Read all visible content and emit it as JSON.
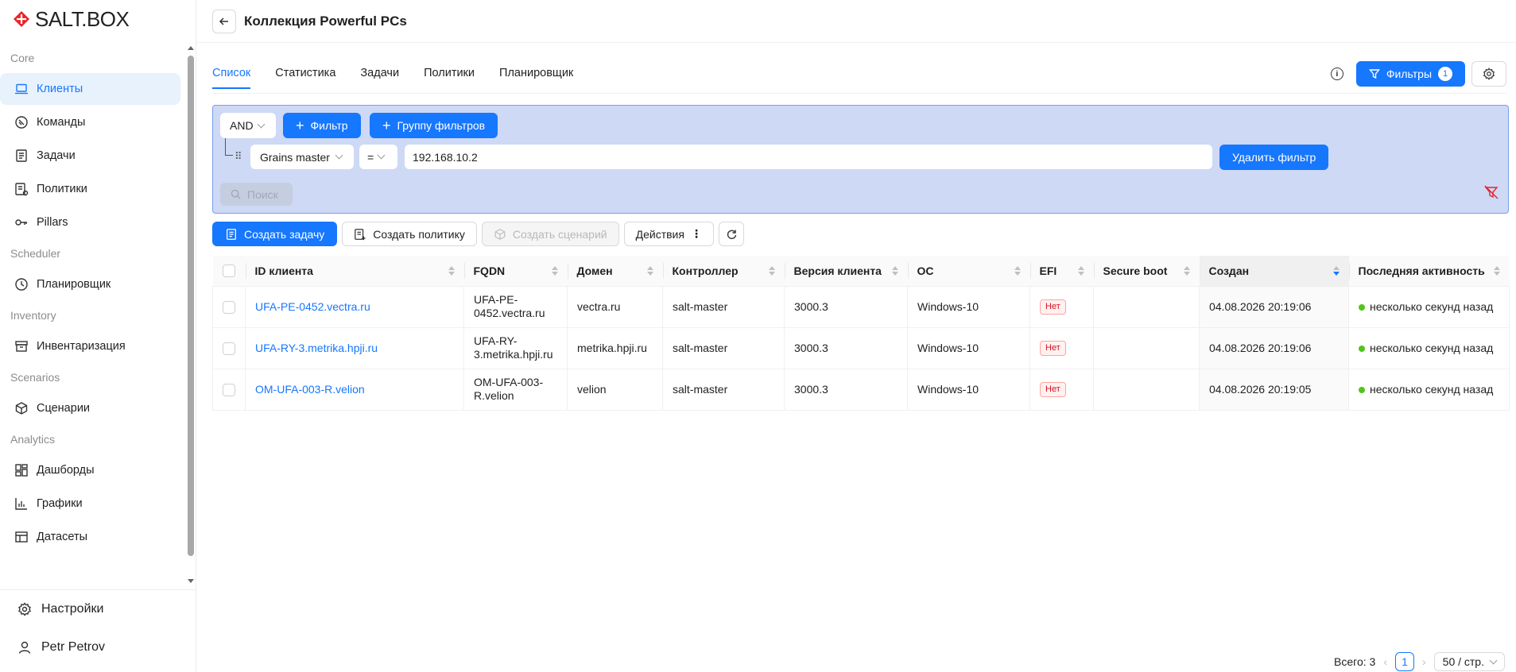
{
  "brand": {
    "logo_text": "SALT.BOX",
    "accent": "#1677ff",
    "logo_red": "#e8242a"
  },
  "sidebar": {
    "sections": [
      {
        "title": "Core",
        "items": [
          {
            "label": "Клиенты",
            "icon": "laptop-icon",
            "active": true
          },
          {
            "label": "Команды",
            "icon": "command-icon"
          },
          {
            "label": "Задачи",
            "icon": "task-list-icon"
          },
          {
            "label": "Политики",
            "icon": "policy-icon"
          },
          {
            "label": "Pillars",
            "icon": "key-icon"
          }
        ]
      },
      {
        "title": "Scheduler",
        "items": [
          {
            "label": "Планировщик",
            "icon": "clock-icon"
          }
        ]
      },
      {
        "title": "Inventory",
        "items": [
          {
            "label": "Инвентаризация",
            "icon": "archive-icon"
          }
        ]
      },
      {
        "title": "Scenarios",
        "items": [
          {
            "label": "Сценарии",
            "icon": "cube-icon"
          }
        ]
      },
      {
        "title": "Analytics",
        "items": [
          {
            "label": "Дашборды",
            "icon": "dashboard-icon"
          },
          {
            "label": "Графики",
            "icon": "chart-icon"
          },
          {
            "label": "Датасеты",
            "icon": "table-icon"
          }
        ]
      }
    ],
    "settings_label": "Настройки",
    "user_name": "Petr Petrov"
  },
  "header": {
    "title": "Коллекция Powerful PCs"
  },
  "tabs": [
    {
      "label": "Список",
      "active": true
    },
    {
      "label": "Статистика"
    },
    {
      "label": "Задачи"
    },
    {
      "label": "Политики"
    },
    {
      "label": "Планировщик"
    }
  ],
  "filters_button": {
    "label": "Фильтры",
    "count": "1"
  },
  "filter_panel": {
    "logic": "AND",
    "add_filter_label": "Фильтр",
    "add_group_label": "Группу фильтров",
    "field": "Grains master",
    "operator": "=",
    "value": "192.168.10.2",
    "delete_label": "Удалить фильтр",
    "search_label": "Поиск"
  },
  "toolbar": {
    "create_task": "Создать задачу",
    "create_policy": "Создать политику",
    "create_scenario": "Создать сценарий",
    "actions": "Действия"
  },
  "table": {
    "columns": [
      "ID клиента",
      "FQDN",
      "Домен",
      "Контроллер",
      "Версия клиента",
      "ОС",
      "EFI",
      "Secure boot",
      "Создан",
      "Последняя активность"
    ],
    "rows": [
      {
        "id": "UFA-PE-0452.vectra.ru",
        "fqdn": "UFA-PE-0452.vectra.ru",
        "domain": "vectra.ru",
        "controller": "salt-master",
        "version": "3000.3",
        "os": "Windows-10",
        "efi": "Нет",
        "secure_boot": "",
        "created": "04.08.2026 20:19:06",
        "activity": "несколько секунд назад"
      },
      {
        "id": "UFA-RY-3.metrika.hpji.ru",
        "fqdn": "UFA-RY-3.metrika.hpji.ru",
        "domain": "metrika.hpji.ru",
        "controller": "salt-master",
        "version": "3000.3",
        "os": "Windows-10",
        "efi": "Нет",
        "secure_boot": "",
        "created": "04.08.2026 20:19:06",
        "activity": "несколько секунд назад"
      },
      {
        "id": "OM-UFA-003-R.velion",
        "fqdn": "OM-UFA-003-R.velion",
        "domain": "velion",
        "controller": "salt-master",
        "version": "3000.3",
        "os": "Windows-10",
        "efi": "Нет",
        "secure_boot": "",
        "created": "04.08.2026 20:19:05",
        "activity": "несколько секунд назад"
      }
    ]
  },
  "pagination": {
    "total_label": "Всего: 3",
    "current_page": "1",
    "page_size": "50 / стр."
  }
}
